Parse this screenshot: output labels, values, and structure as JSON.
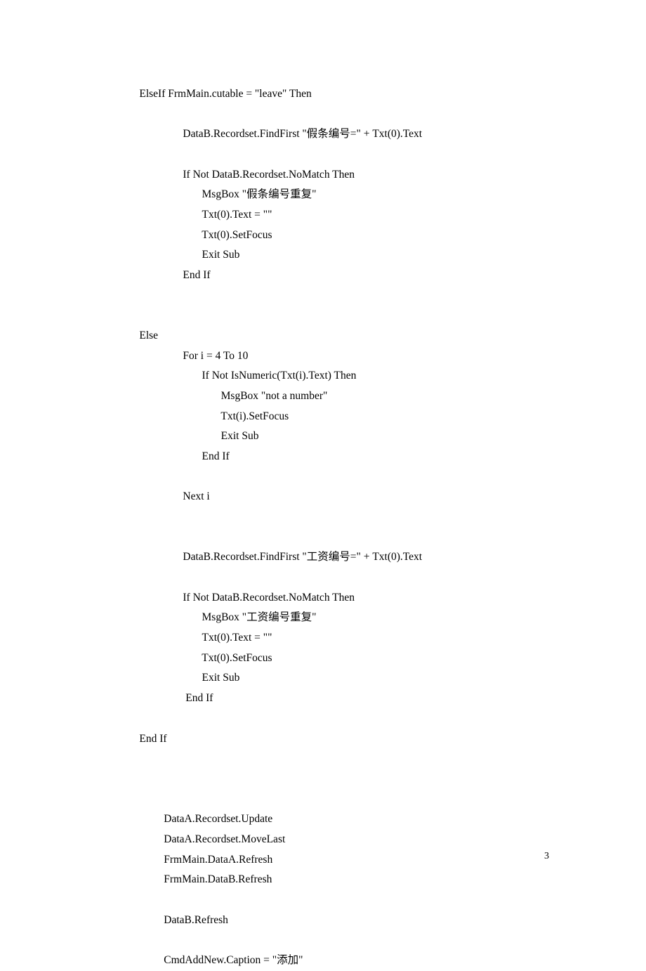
{
  "code": {
    "lines": [
      "             ElseIf FrmMain.cutable = \"leave\" Then",
      "",
      "                             DataB.Recordset.FindFirst \"假条编号=\" + Txt(0).Text",
      "",
      "                             If Not DataB.Recordset.NoMatch Then",
      "                                    MsgBox \"假条编号重复\"",
      "                                    Txt(0).Text = \"\"",
      "                                    Txt(0).SetFocus",
      "                                    Exit Sub",
      "                             End If",
      "",
      "",
      "             Else",
      "                             For i = 4 To 10",
      "                                    If Not IsNumeric(Txt(i).Text) Then",
      "                                           MsgBox \"not a number\"",
      "                                           Txt(i).SetFocus",
      "                                           Exit Sub",
      "                                    End If",
      "",
      "                             Next i",
      "",
      "",
      "                             DataB.Recordset.FindFirst \"工资编号=\" + Txt(0).Text",
      "",
      "                             If Not DataB.Recordset.NoMatch Then",
      "                                    MsgBox \"工资编号重复\"",
      "                                    Txt(0).Text = \"\"",
      "                                    Txt(0).SetFocus",
      "                                    Exit Sub",
      "                              End If",
      "",
      "             End If",
      "",
      "",
      "",
      "                      DataA.Recordset.Update",
      "                      DataA.Recordset.MoveLast",
      "                      FrmMain.DataA.Refresh",
      "                      FrmMain.DataB.Refresh",
      "",
      "                      DataB.Refresh",
      "",
      "                      CmdAddNew.Caption = \"添加\""
    ]
  },
  "page": {
    "number": "3"
  }
}
